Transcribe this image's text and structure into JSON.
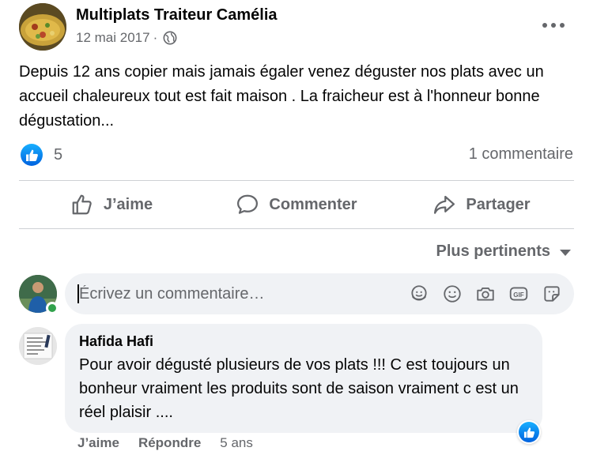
{
  "post": {
    "page_name": "Multiplats Traiteur Camélia",
    "date": "12 mai 2017",
    "separator": "·",
    "text": "Depuis 12 ans copier mais jamais égaler venez déguster nos plats avec un accueil chaleureux tout est fait maison . La fraicheur est à l'honneur bonne dégustation...",
    "reaction_count": "5",
    "comment_count": "1 commentaire"
  },
  "actions": {
    "like": "J’aime",
    "comment": "Commenter",
    "share": "Partager"
  },
  "sort": {
    "label": "Plus pertinents"
  },
  "composer": {
    "placeholder": "Écrivez un commentaire…"
  },
  "comment": {
    "author": "Hafida Hafi",
    "text": "Pour avoir dégusté plusieurs de vos plats !!! C est toujours un bonheur vraiment les produits sont de saison vraiment c est un réel plaisir ....",
    "like": "J’aime",
    "reply": "Répondre",
    "time": "5 ans"
  },
  "colors": {
    "accent": "#1877f2",
    "secondary_text": "#65676b",
    "bubble": "#f0f2f5",
    "online": "#31a24c"
  },
  "icons": [
    "globe-icon",
    "more-icon",
    "like-icon",
    "comment-icon",
    "share-icon",
    "sticker-icon",
    "emoji-icon",
    "camera-icon",
    "gif-icon",
    "avatar-sticker-icon"
  ]
}
